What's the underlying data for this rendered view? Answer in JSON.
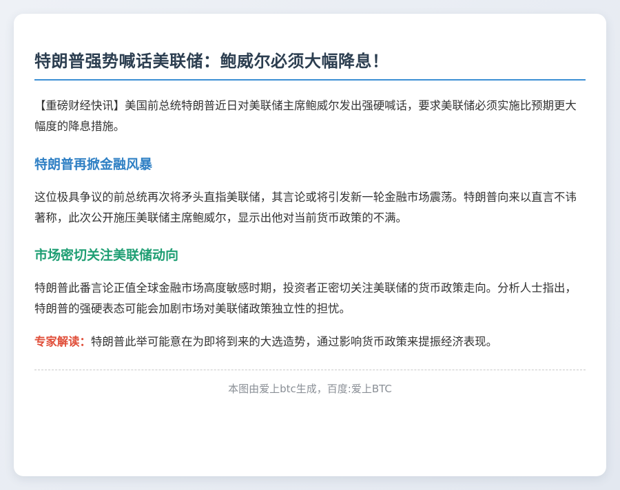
{
  "article": {
    "title": "特朗普强势喊话美联储：鲍威尔必须大幅降息！",
    "intro": "【重磅财经快讯】美国前总统特朗普近日对美联储主席鲍威尔发出强硬喊话，要求美联储必须实施比预期更大幅度的降息措施。",
    "section1": {
      "heading": "特朗普再掀金融风暴",
      "body": "这位极具争议的前总统再次将矛头直指美联储，其言论或将引发新一轮金融市场震荡。特朗普向来以直言不讳著称，此次公开施压美联储主席鲍威尔，显示出他对当前货币政策的不满。"
    },
    "section2": {
      "heading": "市场密切关注美联储动向",
      "body": "特朗普此番言论正值全球金融市场高度敏感时期，投资者正密切关注美联储的货币政策走向。分析人士指出，特朗普的强硬表态可能会加剧市场对美联储政策独立性的担忧。"
    },
    "expert": {
      "label": "专家解读：",
      "text": "特朗普此举可能意在为即将到来的大选造势，通过影响货币政策来提振经济表现。"
    },
    "footer": "本图由爱上btc生成，百度:爱上BTC"
  },
  "colors": {
    "title": "#2c3e50",
    "rule": "#3b8fd4",
    "heading_blue": "#2e7fc4",
    "heading_green": "#1e9e73",
    "expert_label": "#e04e39",
    "footer": "#8a8f96"
  }
}
